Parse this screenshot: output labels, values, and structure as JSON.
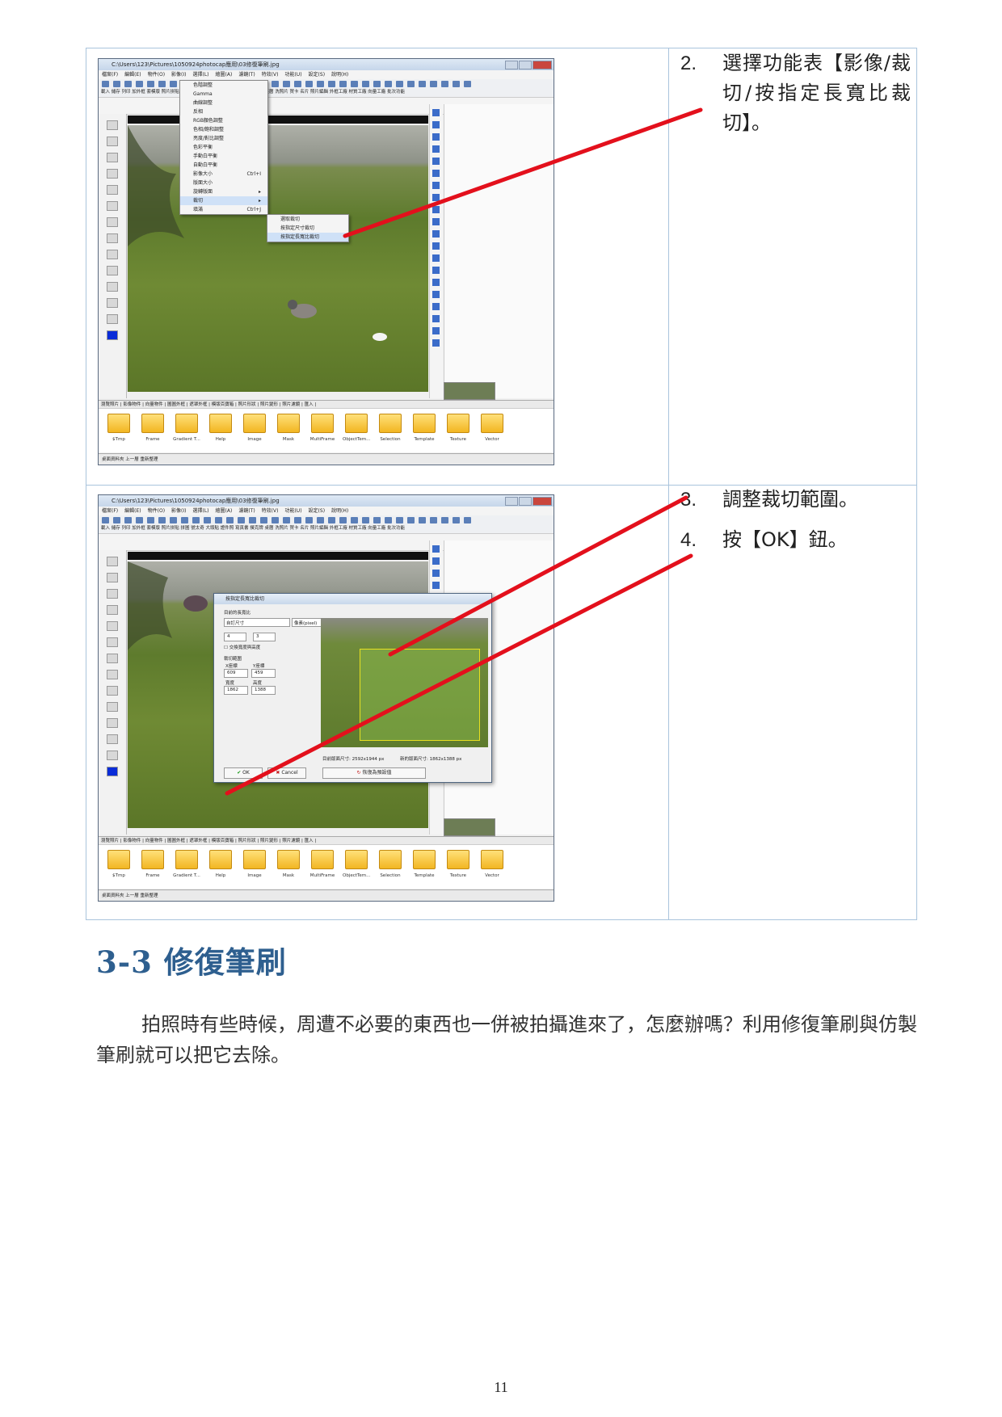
{
  "steps": [
    {
      "num": "2.",
      "text": "選擇功能表【影像/裁切/按指定長寬比裁切】。"
    },
    {
      "num": "3.",
      "text": "調整裁切範圍。"
    },
    {
      "num": "4.",
      "text": "按【OK】鈕。"
    }
  ],
  "screenshot": {
    "window_title": "C:\\Users\\123\\Pictures\\1050924photocap應用\\03修復筆刷.jpg",
    "menus": [
      "檔案(F)",
      "編輯(E)",
      "物件(O)",
      "影像(I)",
      "選擇(L)",
      "繪圖(A)",
      "濾鏡(T)",
      "特效(V)",
      "功能(U)",
      "設定(S)",
      "說明(H)"
    ],
    "toolbar_labels": "載入 儲存 列印 加外框 套模版 照片拼貼 拼圖 號太奇 大頭貼 證件照 寫真書 撲克牌 桌曆 洗照片 賀卡 名片 照片編輯 外框工廠 材質工廠 向量工廠 批次功能",
    "image_menu": [
      {
        "label": "色階調整",
        "shortcut": ""
      },
      {
        "label": "Gamma",
        "shortcut": ""
      },
      {
        "label": "曲線調整",
        "shortcut": ""
      },
      {
        "label": "反相",
        "shortcut": ""
      },
      {
        "label": "RGB顏色調整",
        "shortcut": ""
      },
      {
        "label": "色相/飽和調整",
        "shortcut": ""
      },
      {
        "label": "亮度/對比調整",
        "shortcut": ""
      },
      {
        "label": "色彩平衡",
        "shortcut": ""
      },
      {
        "label": "手動白平衡",
        "shortcut": ""
      },
      {
        "label": "自動白平衡",
        "shortcut": ""
      },
      {
        "label": "影像大小",
        "shortcut": "Ctrl+I"
      },
      {
        "label": "版面大小",
        "shortcut": ""
      },
      {
        "label": "旋轉版面",
        "shortcut": "▸"
      },
      {
        "label": "裁切",
        "shortcut": "▸"
      },
      {
        "label": "填滿",
        "shortcut": "Ctrl+J"
      }
    ],
    "crop_submenu": [
      "選取裁切",
      "按指定尺寸裁切",
      "按指定長寬比裁切"
    ],
    "bottom_tabs": "瀏覽照片 | 影像物件 | 向量物件 | 圖圖外框 | 遮罩外框 | 模版百寶箱 | 照片形狀 | 照片變形 | 照片濾鏡 | 匯入 |",
    "folders": [
      "$Tmp",
      "Frame",
      "Gradient T...",
      "Help",
      "Image",
      "Mask",
      "MultiFrame",
      "ObjectTem...",
      "Selection",
      "Template",
      "Texture",
      "Vector"
    ],
    "status_bar": "桌面資料夾   上一層   重新整理",
    "dialog": {
      "title": "按指定長寬比裁切",
      "ratio_group": "目前的長寬比",
      "ratio_select": "自訂尺寸",
      "unit_select": "像素(pixel)",
      "ratio_w": "4",
      "ratio_h": "3",
      "swap_label": "交換寬度與高度",
      "range_group": "裁切範圍",
      "x_label": "X座標",
      "y_label": "Y座標",
      "x_value": "609",
      "y_value": "459",
      "w_label": "寬度",
      "h_label": "高度",
      "w_value": "1862",
      "h_value": "1388",
      "current_size": "目前版面尺寸: 2592x1944 px",
      "new_size": "新的版面尺寸: 1862x1388 px",
      "ok": "OK",
      "cancel": "Cancel",
      "reset": "恢復為預設值"
    }
  },
  "section": {
    "title": "3-3 修復筆刷",
    "paragraph": "拍照時有些時候，周遭不必要的東西也一併被拍攝進來了，怎麼辦嗎？利用修復筆刷與仿製筆刷就可以把它去除。"
  },
  "page_number": "11",
  "colors": {
    "heading": "#2e5f8f",
    "annotation_line": "#e3101c",
    "table_border": "#a9c4dc"
  }
}
